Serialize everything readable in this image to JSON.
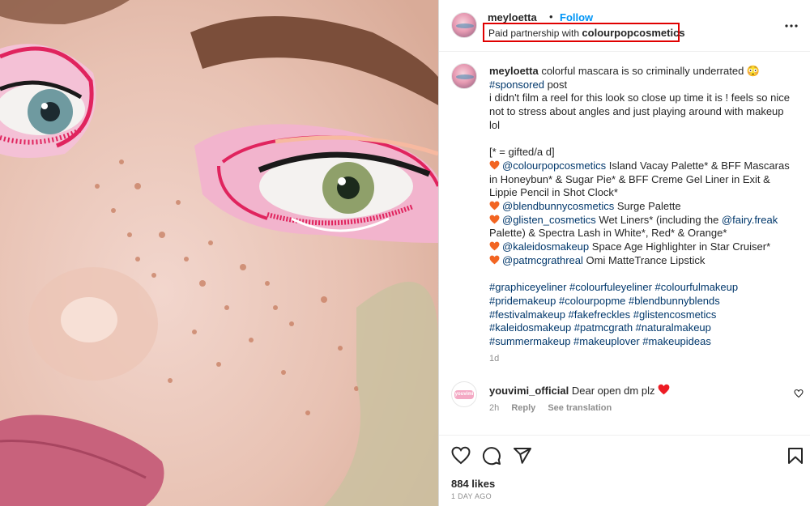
{
  "photo": {
    "alt_icon": "makeup-closeup-photo"
  },
  "header": {
    "username": "meyloetta",
    "separator": "•",
    "follow_label": "Follow",
    "partnership_prefix": "Paid partnership with",
    "partnership_brand": "colourpopcosmetics",
    "more_icon": "more-options-icon"
  },
  "caption": {
    "username": "meyloetta",
    "line1_text": " colorful mascara is so criminally underrated 😳",
    "sponsored_tag": "#sponsored",
    "sponsored_after": " post",
    "body_lines": [
      "i didn't film a reel for this look so close up time it is ! feels so nice",
      "not to stress about angles and just playing around with makeup",
      "lol"
    ],
    "gifted_line": "[* = gifted/a d]",
    "product_lines": [
      {
        "heart": true,
        "mention": "@colourpopcosmetics",
        "text": " Island Vacay Palette* & BFF Mascaras"
      },
      {
        "heart": false,
        "mention": "",
        "text": "in Honeybun* & Sugar Pie* & BFF Creme Gel Liner in Exit &"
      },
      {
        "heart": false,
        "mention": "",
        "text": "Lippie Pencil in Shot Clock*"
      },
      {
        "heart": true,
        "mention": "@blendbunnycosmetics",
        "text": " Surge Palette"
      },
      {
        "heart": true,
        "mention": "@glisten_cosmetics",
        "text": " Wet Liners* (including the ",
        "mention2": "@fairy.freak"
      },
      {
        "heart": false,
        "mention": "",
        "text": "Palette) & Spectra Lash in White*, Red* & Orange*"
      },
      {
        "heart": true,
        "mention": "@kaleidosmakeup",
        "text": " Space Age Highlighter in Star Cruiser*"
      },
      {
        "heart": true,
        "mention": "@patmcgrathreal",
        "text": " Omi MatteTrance Lipstick"
      }
    ],
    "hashtag_lines": [
      "#graphiceyeliner #colourfuleyeliner #colourfulmakeup",
      "#pridemakeup #colourpopme #blendbunnyblends",
      "#festivalmakeup #fakefreckles #glistencosmetics",
      "#kaleidosmakeup #patmcgrath #naturalmakeup",
      "#summermakeup #makeuplover #makeupideas"
    ],
    "time": "1d"
  },
  "comment": {
    "avatar_text": "youvimi",
    "username": "youvimi_official",
    "text": " Dear open dm plz",
    "time": "2h",
    "reply_label": "Reply",
    "translate_label": "See translation"
  },
  "actions": {
    "likes": "884 likes",
    "date": "1 DAY AGO"
  },
  "colors": {
    "accent": "#0095f6",
    "link": "#00376b",
    "heart_orange": "#f26522",
    "heart_red": "#ed1c24",
    "highlight_border": "#e00000"
  }
}
